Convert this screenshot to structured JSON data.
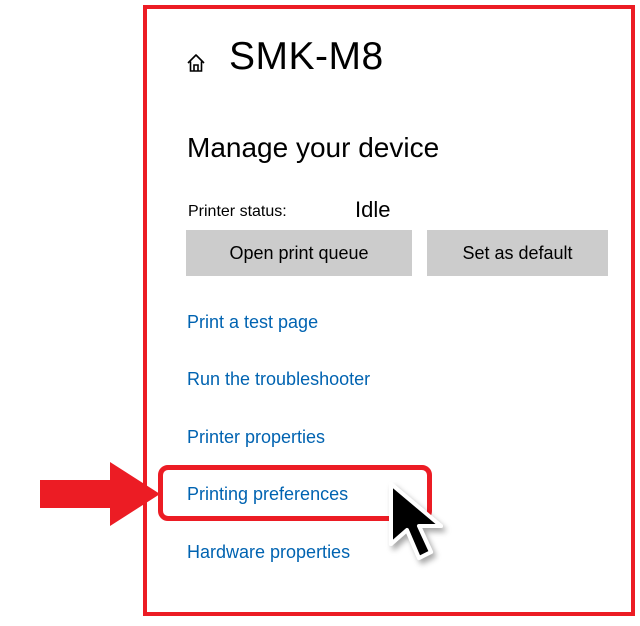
{
  "header": {
    "title": "SMK-M8",
    "icon": "home-icon"
  },
  "section": {
    "title": "Manage your device"
  },
  "status": {
    "label": "Printer status:",
    "value": "Idle"
  },
  "buttons": {
    "open_queue": "Open print queue",
    "set_default": "Set as default"
  },
  "links": [
    {
      "label": "Print a test page"
    },
    {
      "label": "Run the troubleshooter"
    },
    {
      "label": "Printer properties"
    },
    {
      "label": "Printing preferences"
    },
    {
      "label": "Hardware properties"
    }
  ],
  "colors": {
    "accent_link": "#0063b1",
    "highlight": "#ec1c24",
    "button_bg": "#cccccc"
  }
}
